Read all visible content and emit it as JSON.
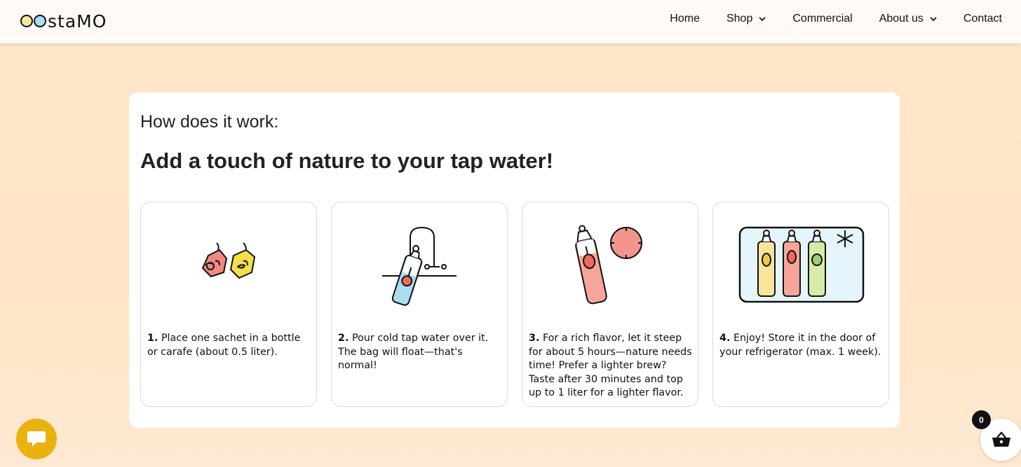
{
  "header": {
    "logo": {
      "text": "staMO"
    },
    "nav": [
      {
        "label": "Home",
        "has_dropdown": false
      },
      {
        "label": "Shop",
        "has_dropdown": true
      },
      {
        "label": "Commercial",
        "has_dropdown": false
      },
      {
        "label": "About us",
        "has_dropdown": true
      },
      {
        "label": "Contact",
        "has_dropdown": false
      }
    ]
  },
  "section": {
    "eyebrow": "How does it work:",
    "headline": "Add a touch of nature to your tap water!",
    "steps": [
      {
        "num": "1.",
        "text": "Place one sachet in a bottle or carafe (about 0.5 liter).",
        "icon": "sachets-icon"
      },
      {
        "num": "2.",
        "text": "Pour cold tap water over it. The bag will float—that's normal!",
        "icon": "tap-bottle-icon"
      },
      {
        "num": "3.",
        "text": "For a rich flavor, let it steep for about 5 hours—nature needs time! Prefer a lighter brew? Taste after 30 minutes and top up to 1 liter for a lighter flavor.",
        "icon": "bottle-clock-icon"
      },
      {
        "num": "4.",
        "text": "Enjoy! Store it in the door of your refrigerator (max. 1 week).",
        "icon": "fridge-bottles-icon"
      }
    ]
  },
  "cart": {
    "count": "0"
  },
  "colors": {
    "background": "#ffe6cb",
    "logo_dot_yellow": "#f6e79a",
    "logo_dot_blue": "#a9ddf0",
    "chat_button": "#e8b20f",
    "red_fruit": "#f08a80",
    "yellow_fruit": "#f6de4a",
    "water_blue": "#a9ddf0"
  }
}
